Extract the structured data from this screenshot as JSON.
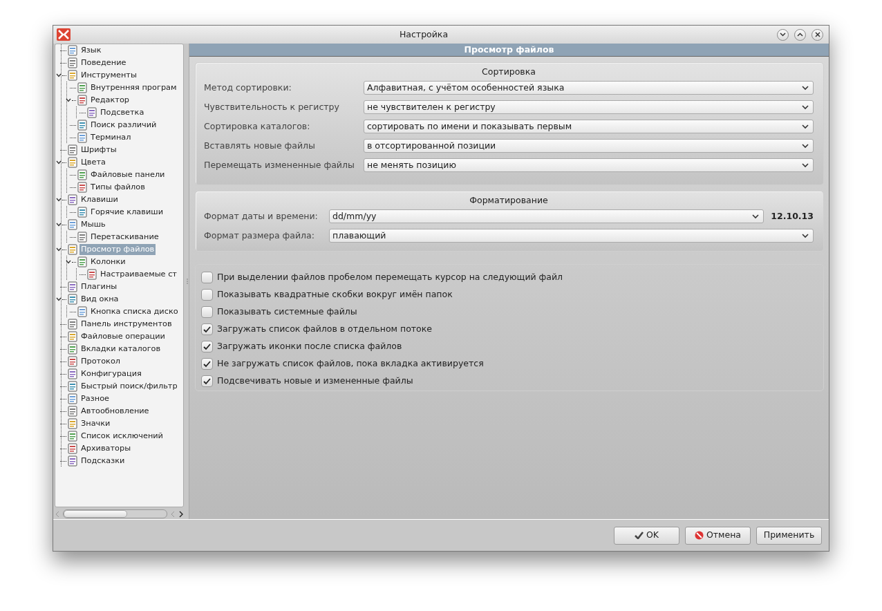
{
  "window": {
    "title": "Настройка"
  },
  "sidebar": {
    "tree": [
      {
        "label": "Язык",
        "selected": false
      },
      {
        "label": "Поведение",
        "selected": false
      },
      {
        "label": "Инструменты",
        "selected": false,
        "expanded": true,
        "children": [
          {
            "label": "Внутренняя програм",
            "selected": false
          },
          {
            "label": "Редактор",
            "selected": false,
            "expanded": true,
            "children": [
              {
                "label": "Подсветка",
                "selected": false
              }
            ]
          },
          {
            "label": "Поиск различий",
            "selected": false
          },
          {
            "label": "Терминал",
            "selected": false
          }
        ]
      },
      {
        "label": "Шрифты",
        "selected": false
      },
      {
        "label": "Цвета",
        "selected": false,
        "expanded": true,
        "children": [
          {
            "label": "Файловые панели",
            "selected": false
          },
          {
            "label": "Типы файлов",
            "selected": false
          }
        ]
      },
      {
        "label": "Клавиши",
        "selected": false,
        "expanded": true,
        "children": [
          {
            "label": "Горячие клавиши",
            "selected": false
          }
        ]
      },
      {
        "label": "Мышь",
        "selected": false,
        "expanded": true,
        "children": [
          {
            "label": "Перетаскивание",
            "selected": false
          }
        ]
      },
      {
        "label": "Просмотр файлов",
        "selected": true,
        "expanded": true,
        "children": [
          {
            "label": "Колонки",
            "selected": false,
            "expanded": true,
            "children": [
              {
                "label": "Настраиваемые ст",
                "selected": false
              }
            ]
          }
        ]
      },
      {
        "label": "Плагины",
        "selected": false
      },
      {
        "label": "Вид окна",
        "selected": false,
        "expanded": true,
        "children": [
          {
            "label": "Кнопка списка диско",
            "selected": false
          }
        ]
      },
      {
        "label": "Панель инструментов",
        "selected": false
      },
      {
        "label": "Файловые операции",
        "selected": false
      },
      {
        "label": "Вкладки каталогов",
        "selected": false
      },
      {
        "label": "Протокол",
        "selected": false
      },
      {
        "label": "Конфигурация",
        "selected": false
      },
      {
        "label": "Быстрый поиск/фильтр",
        "selected": false
      },
      {
        "label": "Разное",
        "selected": false
      },
      {
        "label": "Автообновление",
        "selected": false
      },
      {
        "label": "Значки",
        "selected": false
      },
      {
        "label": "Список исключений",
        "selected": false
      },
      {
        "label": "Архиваторы",
        "selected": false
      },
      {
        "label": "Подсказки",
        "selected": false
      }
    ]
  },
  "page_header": "Просмотр файлов",
  "groups": [
    {
      "title": "Сортировка",
      "fields": [
        {
          "label": "Метод сортировки:",
          "value": "Алфавитная, с учётом особенностей языка"
        },
        {
          "label": "Чувствительность к регистру",
          "value": "не чувствителен к регистру"
        },
        {
          "label": "Сортировка каталогов:",
          "value": "сортировать по имени и показывать первым"
        },
        {
          "label": "Вставлять новые файлы",
          "value": "в отсортированной позиции"
        },
        {
          "label": "Перемещать измененные файлы",
          "value": "не менять позицию"
        }
      ]
    },
    {
      "title": "Форматирование",
      "fields": [
        {
          "label": "Формат даты и времени:",
          "value": "dd/mm/yy",
          "preview": "12.10.13"
        },
        {
          "label": "Формат размера файла:",
          "value": "плавающий"
        }
      ]
    }
  ],
  "checkboxes": [
    {
      "label": "При выделении файлов пробелом перемещать курсор на следующий файл",
      "checked": false
    },
    {
      "label": "Показывать квадратные скобки вокруг имён папок",
      "checked": false
    },
    {
      "label": "Показывать системные файлы",
      "checked": false
    },
    {
      "label": "Загружать список файлов в отдельном потоке",
      "checked": true
    },
    {
      "label": "Загружать иконки после списка файлов",
      "checked": true
    },
    {
      "label": "Не загружать список файлов, пока вкладка активируется",
      "checked": true
    },
    {
      "label": "Подсвечивать новые и измененные файлы",
      "checked": true
    }
  ],
  "buttons": [
    {
      "label": "OK",
      "kind": "ok"
    },
    {
      "label": "Отмена",
      "kind": "cancel"
    },
    {
      "label": "Применить",
      "kind": "apply"
    }
  ]
}
